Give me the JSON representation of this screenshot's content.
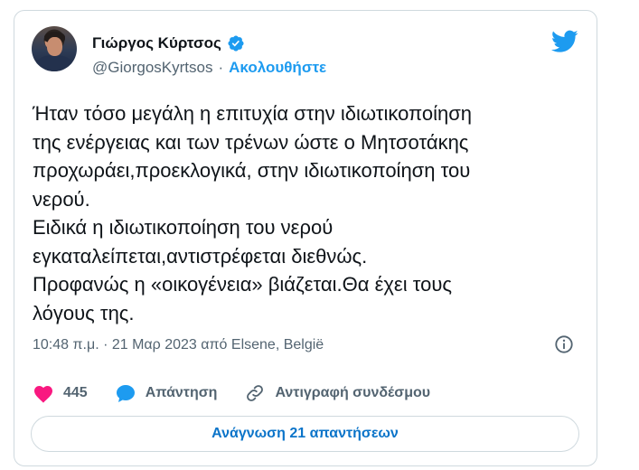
{
  "author": {
    "name": "Γιώργος Κύρτσος",
    "handle": "@GiorgosKyrtsos",
    "separator": "·",
    "follow_label": "Ακολουθήστε",
    "verified_icon": "verified-badge-icon",
    "avatar_icon": "avatar-photo"
  },
  "brand": {
    "icon": "twitter-bird-icon",
    "color": "#1d9bf0"
  },
  "tweet": {
    "text": "Ήταν τόσο μεγάλη η επιτυχία στην ιδιωτικοποίηση\nτης ενέργειας και των τρένων ώστε ο Μητσοτάκης\nπροχωράει,προεκλογικά, στην ιδιωτικοποίηση του\nνερού.\nΕιδικά η ιδιωτικοποίηση του νερού\nεγκαταλείπεται,αντιστρέφεται διεθνώς.\nΠροφανώς η «οικογένεια» βιάζεται.Θα έχει τους\nλόγους της.",
    "timestamp": "10:48 π.μ. · 21 Μαρ 2023 από Elsene, België"
  },
  "actions": {
    "likes_count": "445",
    "reply_label": "Απάντηση",
    "copy_link_label": "Αντιγραφή συνδέσμου"
  },
  "read_replies_label": "Ανάγνωση 21 απαντήσεων",
  "colors": {
    "accent": "#1d9bf0",
    "like": "#f91880",
    "text": "#0f1419",
    "muted": "#536471",
    "border": "#cfd9de"
  }
}
